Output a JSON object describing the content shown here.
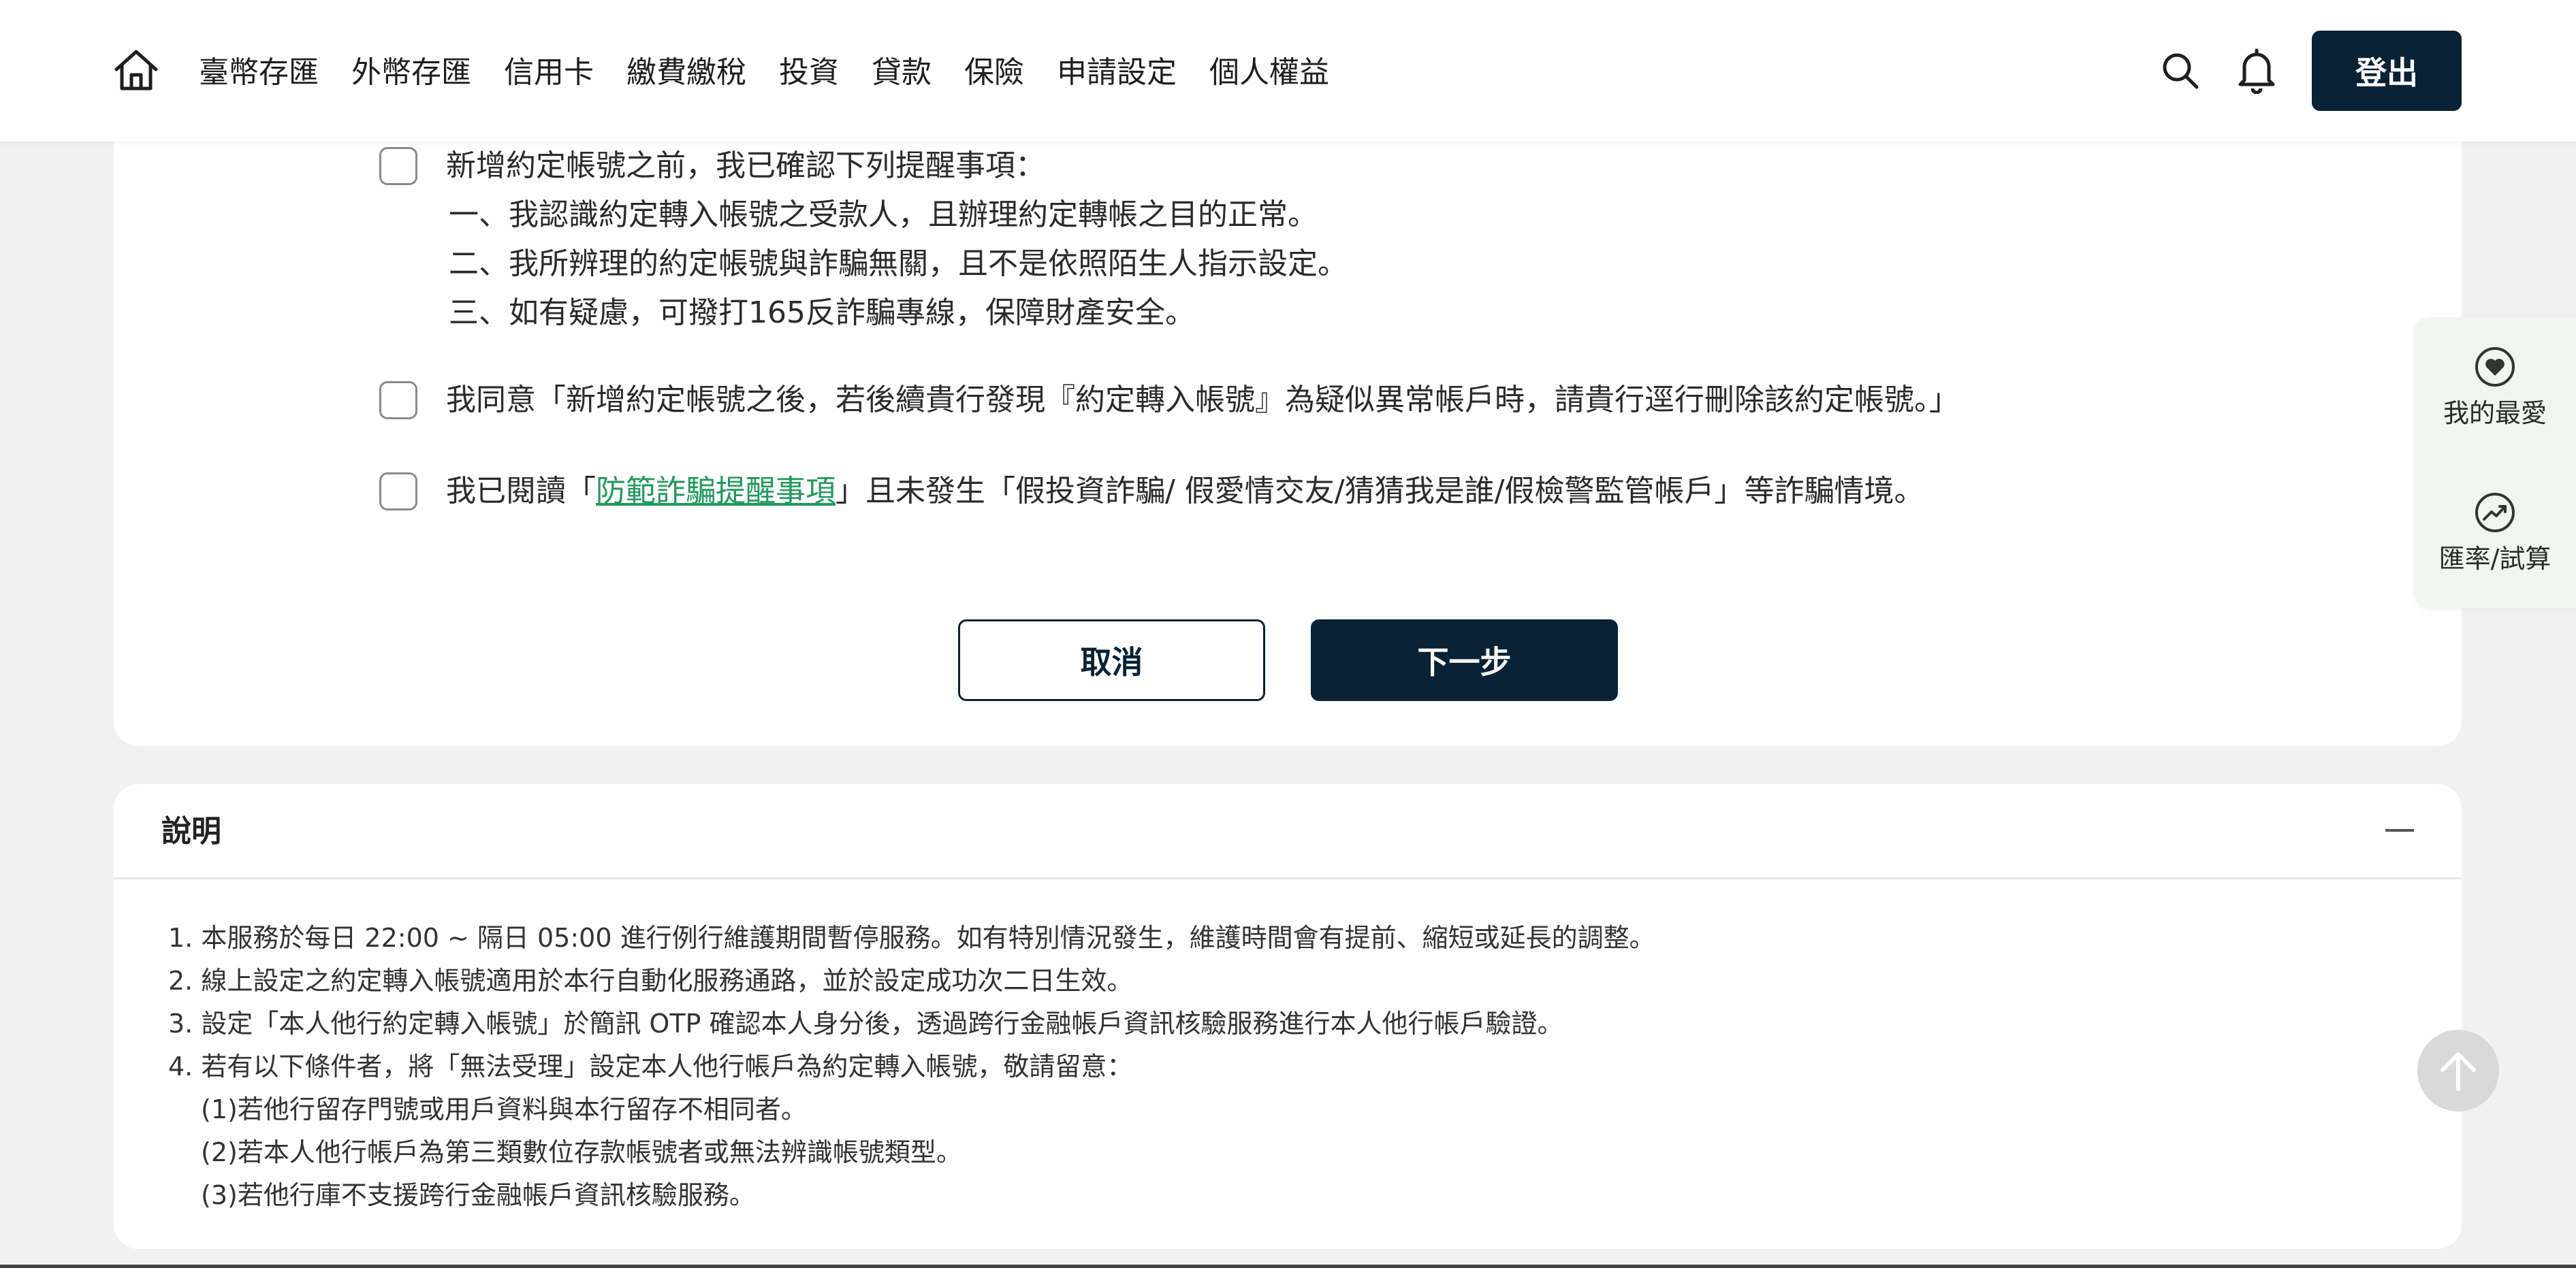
{
  "header": {
    "nav": [
      "臺幣存匯",
      "外幣存匯",
      "信用卡",
      "繳費繳稅",
      "投資",
      "貸款",
      "保險",
      "申請設定",
      "個人權益"
    ],
    "logout_label": "登出"
  },
  "agreement": {
    "item1": {
      "title": "新增約定帳號之前，我已確認下列提醒事項：",
      "lines": [
        "一、我認識約定轉入帳號之受款人，且辦理約定轉帳之目的正常。",
        "二、我所辨理的約定帳號與詐騙無關，且不是依照陌生人指示設定。",
        "三、如有疑慮，可撥打165反詐騙專線，保障財產安全。"
      ]
    },
    "item2": "我同意「新增約定帳號之後，若後續貴行發現『約定轉入帳號』為疑似異常帳戶時，請貴行逕行刪除該約定帳號。」",
    "item3": {
      "prefix": "我已閱讀「",
      "link": "防範詐騙提醒事項",
      "suffix": "」且未發生「假投資詐騙/ 假愛情交友/猜猜我是誰/假檢警監管帳戶」等詐騙情境。"
    },
    "cancel_label": "取消",
    "next_label": "下一步"
  },
  "notes": {
    "title": "說明",
    "lines": [
      "1. 本服務於每日 22:00 ~ 隔日 05:00 進行例行維護期間暫停服務。如有特別情況發生，維護時間會有提前、縮短或延長的調整。",
      "2. 線上設定之約定轉入帳號適用於本行自動化服務通路，並於設定成功次二日生效。",
      "3. 設定「本人他行約定轉入帳號」於簡訊 OTP 確認本人身分後，透過跨行金融帳戶資訊核驗服務進行本人他行帳戶驗證。",
      "4. 若有以下條件者，將「無法受理」設定本人他行帳戶為約定轉入帳號，敬請留意："
    ],
    "sub_lines": [
      "(1)若他行留存門號或用戶資料與本行留存不相同者。",
      "(2)若本人他行帳戶為第三類數位存款帳號者或無法辨識帳號類型。",
      "(3)若他行庫不支援跨行金融帳戶資訊核驗服務。"
    ]
  },
  "side": {
    "favorites": "我的最愛",
    "rates": "匯率/試算"
  },
  "icons": {
    "home": "home-icon",
    "search": "search-icon",
    "bell": "bell-icon",
    "heart": "heart-icon",
    "trend": "trend-icon",
    "up": "arrow-up-icon",
    "collapse": "minus-icon"
  },
  "colors": {
    "primary": "#0a2236",
    "link": "#1f9a5b",
    "side_bg": "#eef6ef"
  }
}
